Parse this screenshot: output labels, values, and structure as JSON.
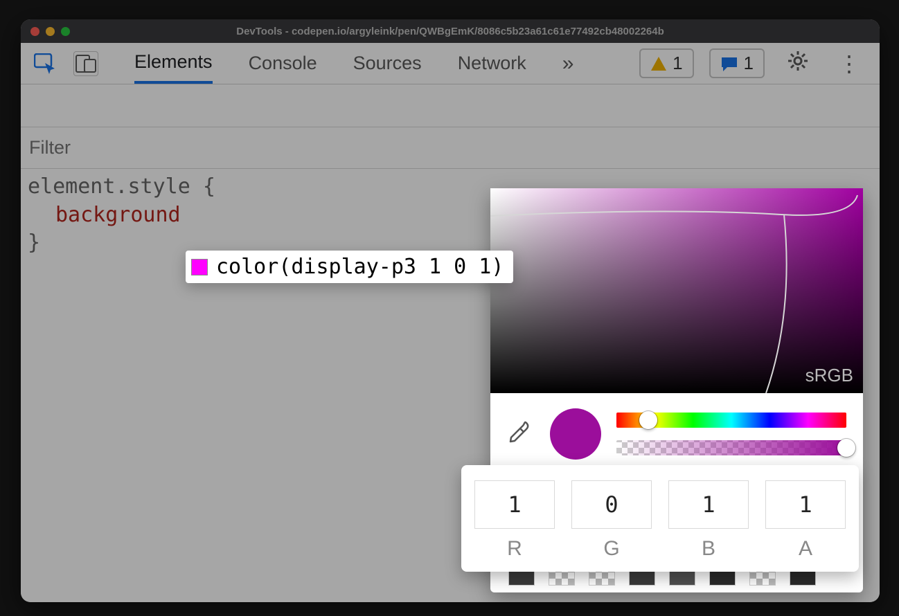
{
  "window": {
    "title": "DevTools - codepen.io/argyleink/pen/QWBgEmK/8086c5b23a61c61e77492cb48002264b"
  },
  "toolbar": {
    "tabs": [
      "Elements",
      "Console",
      "Sources",
      "Network"
    ],
    "active_tab": "Elements",
    "more_glyph": "»",
    "warnings": {
      "count": "1"
    },
    "messages": {
      "count": "1"
    }
  },
  "filter": {
    "placeholder": "Filter"
  },
  "styles": {
    "selector_open": "element.style {",
    "property": "background",
    "close": "}"
  },
  "color_value": {
    "text": "color(display-p3 1 0 1)",
    "swatch": "#ff00ff"
  },
  "picker": {
    "gamut_label": "sRGB",
    "hue_thumb_pct": 14,
    "alpha_thumb_pct": 100,
    "current_color": "#9b0e9b",
    "channels": [
      {
        "label": "R",
        "value": "1"
      },
      {
        "label": "G",
        "value": "0"
      },
      {
        "label": "B",
        "value": "1"
      },
      {
        "label": "A",
        "value": "1"
      }
    ],
    "palette": [
      [
        "#8a86d5",
        "#000000",
        "#2a2a2a",
        "#e9c400",
        "#caa500",
        "#ffffff",
        "#ffffff",
        "#9c9c9c"
      ],
      [
        "#a7a7a7",
        "#595959",
        "#4a4a4a",
        "#3a3a3a",
        "chk",
        "chk",
        "#000000",
        "chk"
      ],
      [
        "#3a3a3a",
        "chk",
        "chk",
        "#3a3a3a",
        "#505050",
        "#2a2a2a",
        "chk",
        "#2a2a2a"
      ]
    ]
  }
}
